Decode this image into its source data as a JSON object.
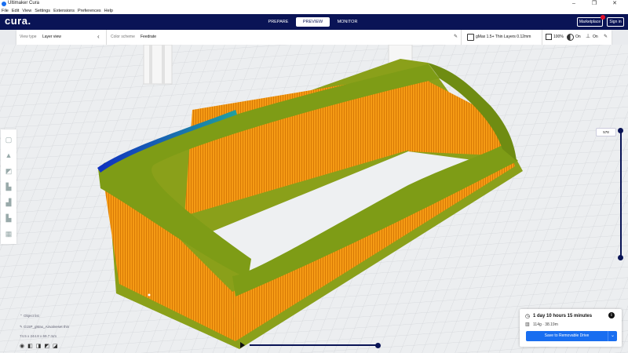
{
  "window": {
    "title": "Ultimaker Cura",
    "controls": [
      "–",
      "❐",
      "✕"
    ]
  },
  "menu": [
    "File",
    "Edit",
    "View",
    "Settings",
    "Extensions",
    "Preferences",
    "Help"
  ],
  "header": {
    "logo": "cura.",
    "stages": [
      {
        "label": "PREPARE",
        "active": false
      },
      {
        "label": "PREVIEW",
        "active": true
      },
      {
        "label": "MONITOR",
        "active": false
      }
    ],
    "marketplace_label": "Marketplace",
    "signin_label": "Sign in"
  },
  "toolbar": {
    "view_type_label": "View type",
    "view_type_value": "Layer view",
    "color_scheme_label": "Color scheme",
    "color_scheme_value": "Feedrate",
    "printer_profile": "gMax 1.5+ Thin Layers 0.12mm",
    "infill_value": "100%",
    "support_value": "On",
    "adhesion_value": "On"
  },
  "layer_slider": {
    "current_layer": "578"
  },
  "object_info": {
    "list_label": "Object list",
    "file_name": "G15P_gMax_Airvalveset thin",
    "dimensions": "74.5 x 244.8 x 69.7 mm"
  },
  "print_info": {
    "time": "1 day 10 hours 15 minutes",
    "material": "114g · 38.19m",
    "save_label": "Save to Removable Drive"
  },
  "colors": {
    "header": "#0a1456",
    "accent": "#196ef0",
    "model_orange": "#f59a14",
    "model_green": "#7e9c16"
  }
}
